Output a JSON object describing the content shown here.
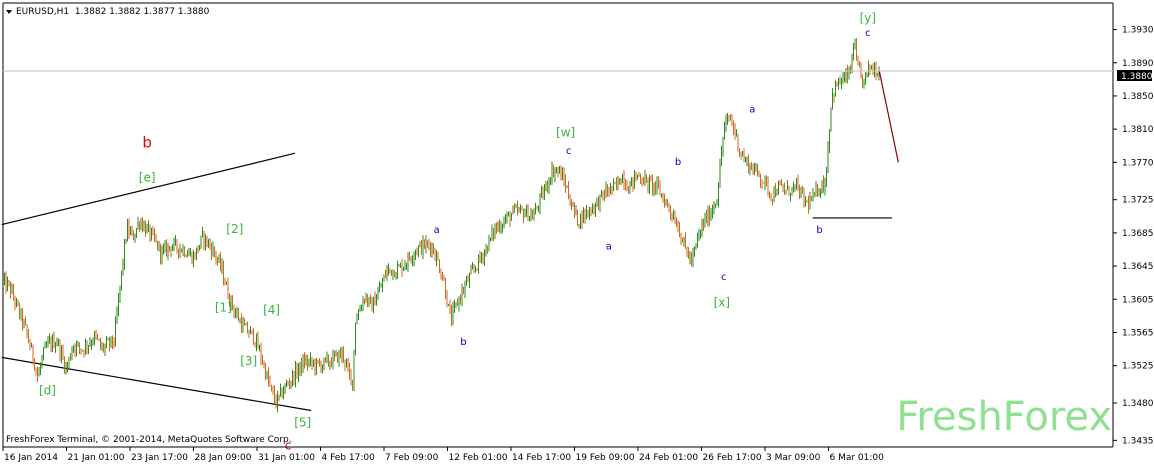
{
  "header": {
    "symbol_line": "EURUSD,H1  1.3882 1.3882 1.3877 1.3880"
  },
  "footer": {
    "copyright": "FreshForex Terminal, © 2001-2014, MetaQuotes Software Corp."
  },
  "watermark": "FreshForex",
  "colors": {
    "background": "#ffffff",
    "axis": "#000000",
    "candle_up": "#2e8b1e",
    "candle_down": "#d2691e",
    "wave_green": "#3cb43c",
    "wave_red": "#e00000",
    "wave_blue": "#0000c8",
    "trend_line": "#000000",
    "projection": "#8b0000",
    "watermark": "#8fe08f",
    "current_price_bg": "#000000",
    "current_price_text": "#ffffff"
  },
  "chart_data": {
    "type": "line",
    "style": "candlestick",
    "symbol": "EURUSD",
    "timeframe": "H1",
    "ohlc_last": {
      "open": 1.3882,
      "high": 1.3882,
      "low": 1.3877,
      "close": 1.388
    },
    "current_price": "1.3880",
    "y_ticks": [
      "1.3930",
      "1.3890",
      "1.3850",
      "1.3810",
      "1.3770",
      "1.3725",
      "1.3685",
      "1.3645",
      "1.3605",
      "1.3565",
      "1.3525",
      "1.3480",
      "1.3435"
    ],
    "ylim": [
      1.3427,
      1.3962
    ],
    "x_ticks": [
      "16 Jan 2014",
      "21 Jan 01:00",
      "23 Jan 17:00",
      "28 Jan 09:00",
      "31 Jan 01:00",
      "4 Feb 17:00",
      "7 Feb 09:00",
      "12 Feb 01:00",
      "14 Feb 17:00",
      "19 Feb 09:00",
      "24 Feb 01:00",
      "26 Feb 17:00",
      "3 Mar 09:00",
      "6 Mar 01:00"
    ],
    "x_tick_index": [
      0,
      1,
      2,
      3,
      4,
      5,
      6,
      7,
      8,
      9,
      10,
      11,
      12,
      13
    ],
    "xlim": [
      -0.02,
      17.4
    ],
    "series": [
      {
        "x": [
          0,
          0.1,
          0.2,
          0.35,
          0.5,
          0.55,
          0.62,
          0.7,
          0.85,
          1.0,
          1.1,
          1.25,
          1.45,
          1.55,
          1.75,
          1.85,
          1.95,
          2.05,
          2.15,
          2.35,
          2.5,
          2.65,
          2.85,
          3.0,
          3.15,
          3.3,
          3.45,
          3.55,
          3.65,
          3.8,
          3.95,
          4.05,
          4.2,
          4.3,
          4.45,
          4.6,
          4.75,
          4.95,
          5.15,
          5.35,
          5.5,
          5.55,
          5.7,
          5.8,
          5.95,
          6.05,
          6.2,
          6.35,
          6.5,
          6.65,
          6.75,
          6.85,
          6.95,
          7.0,
          7.05,
          7.15,
          7.3,
          7.45,
          7.6,
          7.75,
          7.9,
          8.05,
          8.2,
          8.35,
          8.55,
          8.65,
          8.75,
          8.85,
          8.95,
          9.05,
          9.2,
          9.35,
          9.5,
          9.65,
          9.75,
          9.85,
          10.0,
          10.15,
          10.3,
          10.45,
          10.6,
          10.75,
          10.85,
          10.95,
          11.05,
          11.15,
          11.25,
          11.35,
          11.45,
          11.55,
          11.6,
          11.7,
          11.85,
          12.0,
          12.1,
          12.2,
          12.35,
          12.5,
          12.65,
          12.75,
          12.85,
          12.95,
          13.05,
          13.15,
          13.25,
          13.35,
          13.4,
          13.45,
          13.55,
          13.65,
          13.75,
          13.8
        ],
        "close": [
          1.3625,
          1.362,
          1.36,
          1.357,
          1.3528,
          1.351,
          1.3535,
          1.355,
          1.3555,
          1.352,
          1.355,
          1.3545,
          1.356,
          1.3545,
          1.3555,
          1.3625,
          1.369,
          1.368,
          1.37,
          1.368,
          1.366,
          1.367,
          1.3665,
          1.3655,
          1.368,
          1.3665,
          1.364,
          1.361,
          1.359,
          1.357,
          1.356,
          1.354,
          1.35,
          1.348,
          1.35,
          1.3515,
          1.353,
          1.3525,
          1.353,
          1.354,
          1.35,
          1.358,
          1.361,
          1.3595,
          1.362,
          1.364,
          1.364,
          1.365,
          1.3665,
          1.367,
          1.367,
          1.365,
          1.3625,
          1.36,
          1.358,
          1.36,
          1.3625,
          1.3645,
          1.3665,
          1.369,
          1.37,
          1.371,
          1.371,
          1.3705,
          1.374,
          1.376,
          1.376,
          1.3745,
          1.372,
          1.37,
          1.371,
          1.372,
          1.3735,
          1.374,
          1.3755,
          1.374,
          1.3755,
          1.3745,
          1.374,
          1.372,
          1.37,
          1.3665,
          1.365,
          1.368,
          1.37,
          1.371,
          1.373,
          1.381,
          1.3825,
          1.38,
          1.3785,
          1.377,
          1.376,
          1.3745,
          1.373,
          1.374,
          1.3735,
          1.374,
          1.372,
          1.3725,
          1.374,
          1.3745,
          1.385,
          1.3865,
          1.387,
          1.388,
          1.3918,
          1.3885,
          1.3865,
          1.3885,
          1.3882,
          1.388
        ]
      }
    ],
    "projection": {
      "x": [
        13.8,
        14.1
      ],
      "y": [
        1.388,
        1.377
      ]
    },
    "trend_lines": [
      {
        "x": [
          -0.02,
          4.6
        ],
        "y": [
          1.3695,
          1.3781
        ]
      },
      {
        "x": [
          -0.02,
          4.85
        ],
        "y": [
          1.3535,
          1.3471
        ]
      },
      {
        "x": [
          12.75,
          14.0
        ],
        "y": [
          1.3703,
          1.3703
        ]
      }
    ],
    "wave_labels": [
      {
        "text": "b",
        "x": 2.27,
        "y": 1.3788,
        "color": "red",
        "size": "lg"
      },
      {
        "text": "[e]",
        "x": 2.27,
        "y": 1.3747,
        "color": "green"
      },
      {
        "text": "[2]",
        "x": 3.65,
        "y": 1.3685,
        "color": "green"
      },
      {
        "text": "[1]",
        "x": 3.47,
        "y": 1.359,
        "color": "green"
      },
      {
        "text": "[4]",
        "x": 4.23,
        "y": 1.3587,
        "color": "green"
      },
      {
        "text": "[3]",
        "x": 3.87,
        "y": 1.3526,
        "color": "green"
      },
      {
        "text": "[d]",
        "x": 0.7,
        "y": 1.349,
        "color": "green"
      },
      {
        "text": "[5]",
        "x": 4.72,
        "y": 1.3452,
        "color": "green"
      },
      {
        "text": "c",
        "x": 4.49,
        "y": 1.3424,
        "color": "red"
      },
      {
        "text": "a",
        "x": 6.83,
        "y": 1.3685,
        "color": "blue"
      },
      {
        "text": "b",
        "x": 7.25,
        "y": 1.355,
        "color": "blue"
      },
      {
        "text": "[w]",
        "x": 8.86,
        "y": 1.3801,
        "color": "green"
      },
      {
        "text": "c",
        "x": 8.91,
        "y": 1.378,
        "color": "blue"
      },
      {
        "text": "a",
        "x": 9.54,
        "y": 1.3665,
        "color": "blue"
      },
      {
        "text": "b",
        "x": 10.63,
        "y": 1.3767,
        "color": "blue"
      },
      {
        "text": "c",
        "x": 11.35,
        "y": 1.3628,
        "color": "blue"
      },
      {
        "text": "[x]",
        "x": 11.32,
        "y": 1.3596,
        "color": "green"
      },
      {
        "text": "a",
        "x": 11.8,
        "y": 1.383,
        "color": "blue"
      },
      {
        "text": "b",
        "x": 12.86,
        "y": 1.3685,
        "color": "blue"
      },
      {
        "text": "[y]",
        "x": 13.62,
        "y": 1.3939,
        "color": "green"
      },
      {
        "text": "c",
        "x": 13.62,
        "y": 1.3922,
        "color": "blue"
      }
    ],
    "grid": false,
    "title": "",
    "xlabel": "",
    "ylabel": ""
  }
}
